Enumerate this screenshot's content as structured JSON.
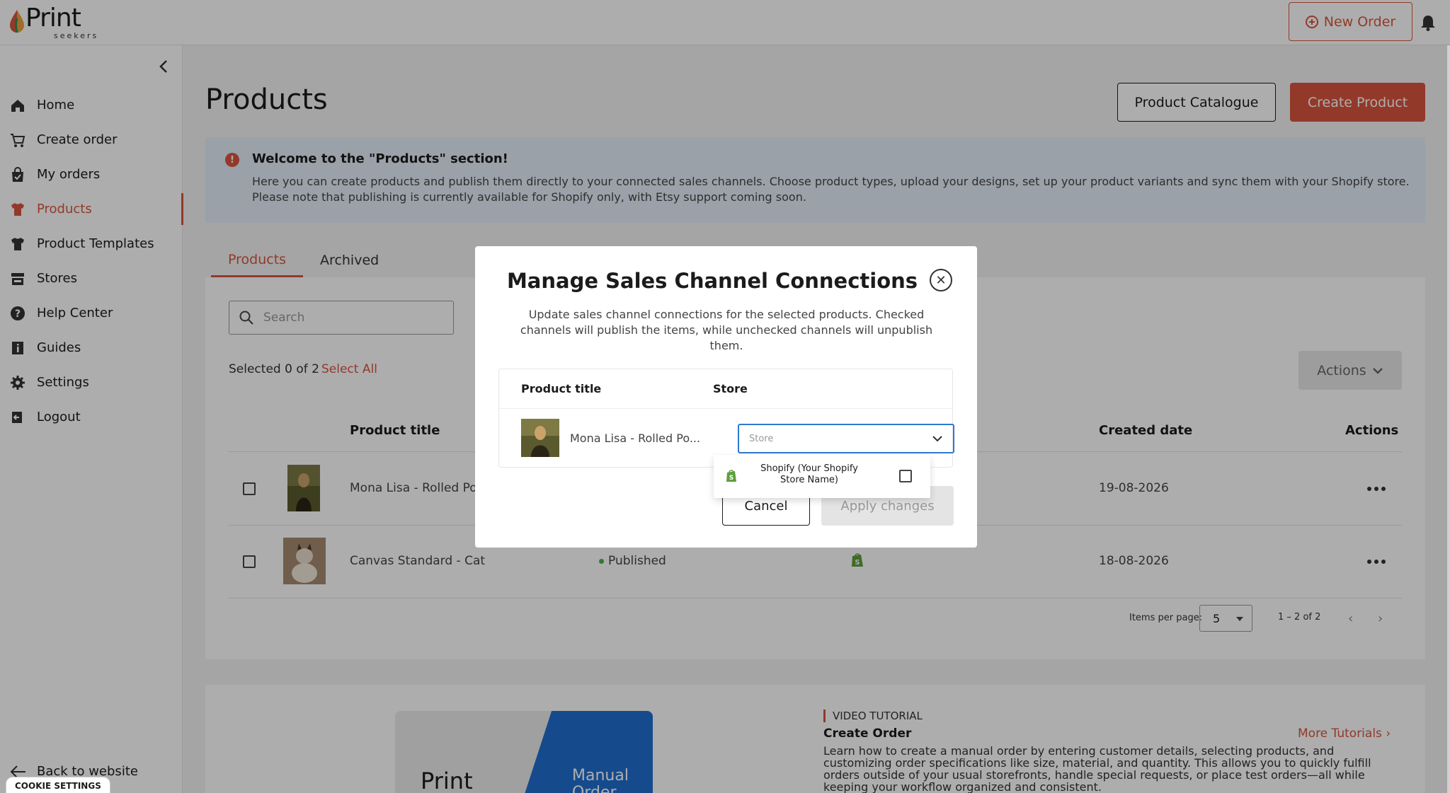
{
  "brand": {
    "name": "Print",
    "sub": "seekers"
  },
  "topbar": {
    "new_order": "New Order"
  },
  "sidebar": {
    "items": [
      {
        "label": "Home",
        "icon": "home-icon"
      },
      {
        "label": "Create order",
        "icon": "cart-icon"
      },
      {
        "label": "My orders",
        "icon": "bag-icon"
      },
      {
        "label": "Products",
        "icon": "shirt-icon",
        "active": true
      },
      {
        "label": "Product Templates",
        "icon": "shirt-icon"
      },
      {
        "label": "Stores",
        "icon": "store-icon"
      },
      {
        "label": "Help Center",
        "icon": "help-icon"
      },
      {
        "label": "Guides",
        "icon": "guide-icon"
      },
      {
        "label": "Settings",
        "icon": "gear-icon"
      },
      {
        "label": "Logout",
        "icon": "logout-icon"
      }
    ],
    "back_to_website": "Back to website",
    "cookie_settings": "COOKIE SETTINGS"
  },
  "page": {
    "title": "Products",
    "catalogue_button": "Product Catalogue",
    "create_button": "Create Product"
  },
  "info": {
    "title": "Welcome to the \"Products\" section!",
    "text": "Here you can create products and publish them directly to your connected sales channels. Choose product types, upload your designs, set up your product variants and sync them with your Shopify store. Please note that publishing is currently available for Shopify only, with Etsy support coming soon."
  },
  "tabs": [
    "Products",
    "Archived"
  ],
  "search": {
    "placeholder": "Search"
  },
  "selection": {
    "text": "Selected 0 of 2",
    "select_all": "Select All"
  },
  "actions_button": "Actions",
  "table": {
    "headers": {
      "product_title": "Product title",
      "created_date": "Created date",
      "actions": "Actions"
    },
    "rows": [
      {
        "title": "Mona Lisa - Rolled Poster",
        "status": "",
        "created": "19-08-2026"
      },
      {
        "title": "Canvas Standard - Cat",
        "status": "Published",
        "created": "18-08-2026"
      }
    ]
  },
  "pagination": {
    "items_label": "Items per page:",
    "per_page": "5",
    "range": "1 – 2 of 2"
  },
  "video": {
    "tag": "VIDEO TUTORIAL",
    "title": "Create Order",
    "more": "More Tutorials",
    "text": "Learn how to create a manual order by entering customer details, selecting products, and customizing order specifications like size, material, and quantity. This allows you to quickly fulfill orders outside of your usual storefronts, handle special requests, or place test orders—all while keeping your workflow organized and consistent.",
    "thumb_print": "Print",
    "thumb_manual": "Manual Order"
  },
  "modal": {
    "title": "Manage Sales Channel Connections",
    "description": "Update sales channel connections for the selected products. Checked channels will publish the items, while unchecked channels will unpublish them.",
    "col_product": "Product title",
    "col_store": "Store",
    "product": "Mona Lisa - Rolled Po...",
    "store_placeholder": "Store",
    "dropdown_option": "Shopify (Your Shopify Store Name)",
    "cancel": "Cancel",
    "apply": "Apply changes"
  },
  "colors": {
    "accent": "#d9553e",
    "info_bg": "#e3eef8",
    "focus": "#2e79cf",
    "published": "#4caf50"
  }
}
